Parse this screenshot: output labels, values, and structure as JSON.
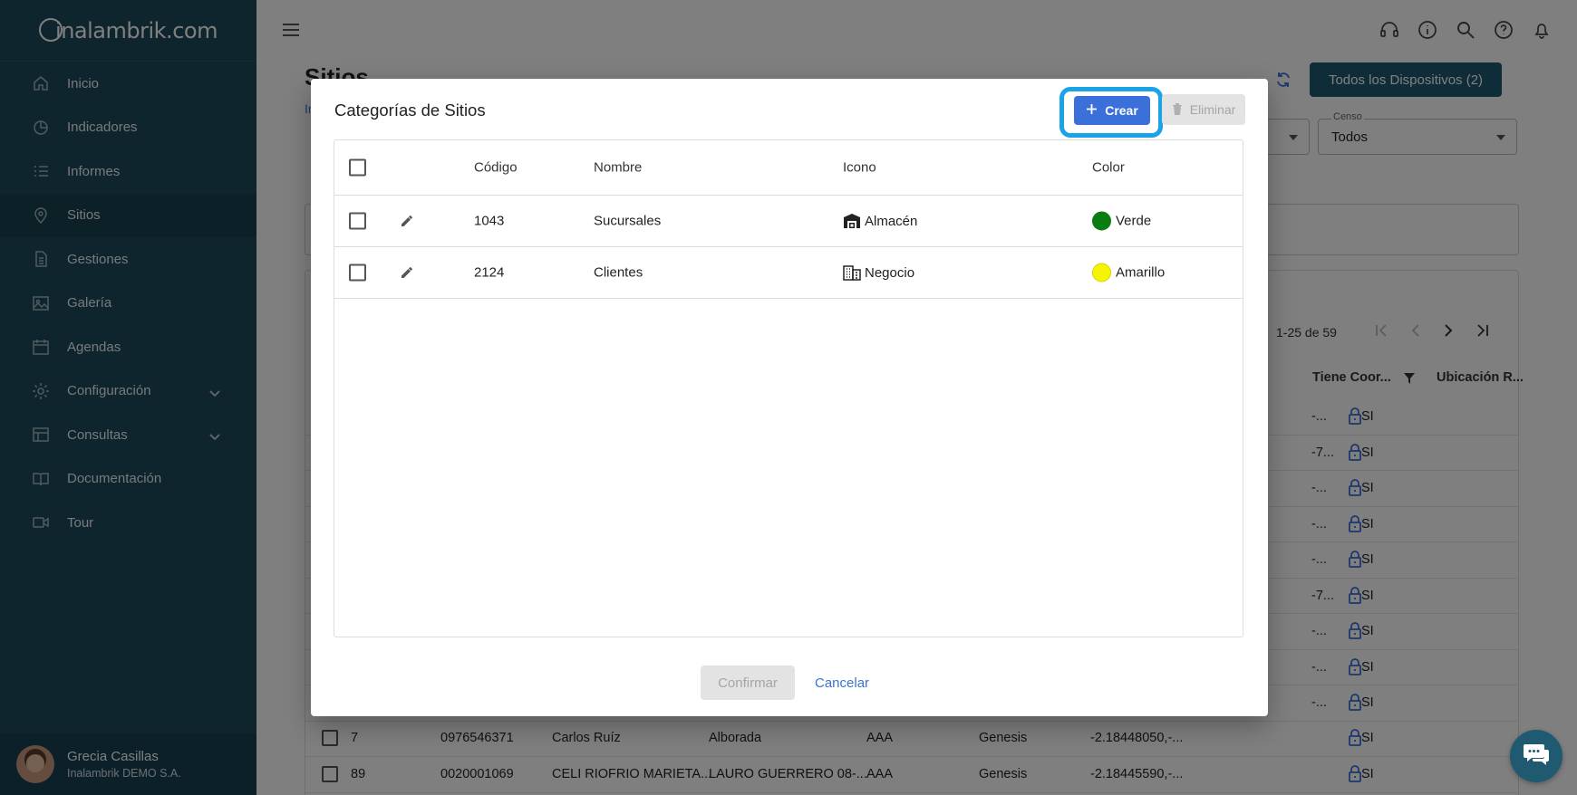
{
  "brand": {
    "logo_text": "nalambrik.com",
    "logo_prefix": "i"
  },
  "sidebar": {
    "items": [
      {
        "label": "Inicio",
        "icon": "home-icon"
      },
      {
        "label": "Indicadores",
        "icon": "pie-chart-icon"
      },
      {
        "label": "Informes",
        "icon": "list-icon"
      },
      {
        "label": "Sitios",
        "icon": "location-pin-icon",
        "active": true
      },
      {
        "label": "Gestiones",
        "icon": "document-icon"
      },
      {
        "label": "Galería",
        "icon": "image-icon"
      },
      {
        "label": "Agendas",
        "icon": "calendar-icon"
      },
      {
        "label": "Configuración",
        "icon": "gear-icon",
        "expandable": true
      },
      {
        "label": "Consultas",
        "icon": "table-icon",
        "expandable": true
      },
      {
        "label": "Documentación",
        "icon": "book-icon"
      },
      {
        "label": "Tour",
        "icon": "video-icon"
      }
    ],
    "user": {
      "name": "Grecia Casillas",
      "org": "Inalambrik DEMO S.A."
    }
  },
  "page": {
    "title": "Sitios",
    "breadcrumb": "In",
    "all_devices_button": "Todos los Dispositivos (2)",
    "censo": {
      "label": "Censo",
      "value": "Todos"
    },
    "pager": {
      "range": "1-25 de 59"
    },
    "columns": {
      "tiene_coor": "Tiene Coor...",
      "ubicacion": "Ubicación R...",
      "partial": "s"
    },
    "background_rows": [
      {
        "coord": "-...",
        "tiene": "SI"
      },
      {
        "coord": "-7...",
        "tiene": "SI"
      },
      {
        "coord": "-...",
        "tiene": "SI"
      },
      {
        "coord": "-...",
        "tiene": "SI"
      },
      {
        "coord": "-...",
        "tiene": "SI"
      },
      {
        "coord": "-7...",
        "tiene": "SI"
      },
      {
        "coord": "-...",
        "tiene": "SI"
      },
      {
        "coord": "-...",
        "tiene": "SI"
      },
      {
        "coord": "-...",
        "tiene": "SI"
      }
    ],
    "visible_rows": [
      {
        "id": "7",
        "code": "0976546371",
        "name": "Carlos Ruíz",
        "address": "Alborada",
        "cat": "AAA",
        "device": "Genesis",
        "coord": "-2.18448050,-...",
        "tiene": "SI"
      },
      {
        "id": "89",
        "code": "0020001069",
        "name": "CELI RIOFRIO MARIETA...",
        "address": "LAURO GUERRERO 08-...",
        "cat": "AAA",
        "device": "Genesis",
        "coord": "-2.18445590,-...",
        "tiene": "SI"
      }
    ]
  },
  "modal": {
    "title": "Categorías de Sitios",
    "create_button": "Crear",
    "delete_button": "Eliminar",
    "headers": {
      "code": "Código",
      "name": "Nombre",
      "icon": "Icono",
      "color": "Color"
    },
    "rows": [
      {
        "code": "1043",
        "name": "Sucursales",
        "icon_label": "Almacén",
        "icon": "warehouse-icon",
        "color_label": "Verde",
        "color": "#0a7d12"
      },
      {
        "code": "2124",
        "name": "Clientes",
        "icon_label": "Negocio",
        "icon": "building-icon",
        "color_label": "Amarillo",
        "color": "#f5f500"
      }
    ],
    "confirm_button": "Confirmar",
    "cancel_button": "Cancelar"
  },
  "colors": {
    "sidebar": "#1c4a5c",
    "primary_button": "#3b6fd9",
    "highlight_ring": "#1aa3e6",
    "dark_button": "#1f5a70"
  }
}
